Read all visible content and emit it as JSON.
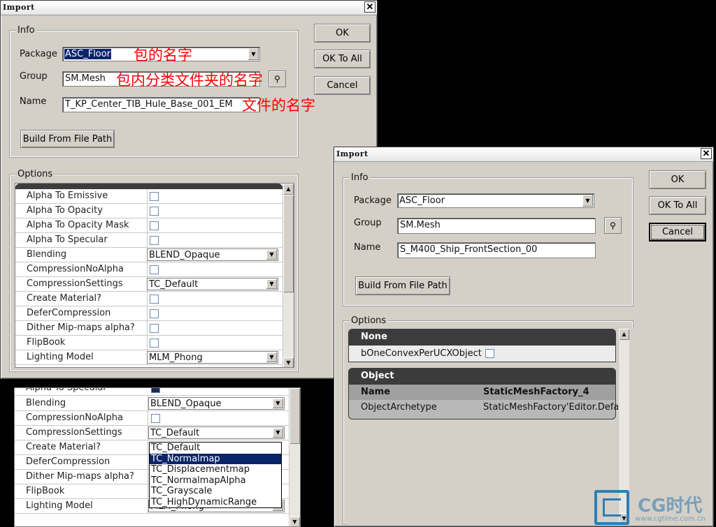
{
  "window1": {
    "title": "Import",
    "close_label": "✕",
    "info_label": "Info",
    "package_label": "Package",
    "package_value": "ASC_Floor",
    "group_label": "Group",
    "group_value": "SM.Mesh",
    "name_label": "Name",
    "name_value": "T_KP_Center_TIB_Hule_Base_001_EM",
    "build_button": "Build From File Path",
    "ok_button": "OK",
    "ok_to_all_button": "OK To All",
    "cancel_button": "Cancel",
    "options_label": "Options",
    "annotations": {
      "package": "包的名字",
      "group": "包内分类文件夹的名字",
      "name": "文件的名字"
    },
    "options": [
      {
        "name": "Alpha To Emissive",
        "type": "checkbox"
      },
      {
        "name": "Alpha To Opacity",
        "type": "checkbox"
      },
      {
        "name": "Alpha To Opacity Mask",
        "type": "checkbox"
      },
      {
        "name": "Alpha To Specular",
        "type": "checkbox"
      },
      {
        "name": "Blending",
        "type": "combo",
        "value": "BLEND_Opaque"
      },
      {
        "name": "CompressionNoAlpha",
        "type": "checkbox"
      },
      {
        "name": "CompressionSettings",
        "type": "combo",
        "value": "TC_Default"
      },
      {
        "name": "Create Material?",
        "type": "checkbox"
      },
      {
        "name": "DeferCompression",
        "type": "checkbox"
      },
      {
        "name": "Dither Mip-maps alpha?",
        "type": "checkbox"
      },
      {
        "name": "FlipBook",
        "type": "checkbox"
      },
      {
        "name": "Lighting Model",
        "type": "combo",
        "value": "MLM_Phong"
      }
    ]
  },
  "window2": {
    "title": "Import",
    "close_label": "✕",
    "info_label": "Info",
    "package_label": "Package",
    "package_value": "ASC_Floor",
    "group_label": "Group",
    "group_value": "SM.Mesh",
    "name_label": "Name",
    "name_value": "S_M400_Ship_FrontSection_00",
    "build_button": "Build From File Path",
    "ok_button": "OK",
    "ok_to_all_button": "OK To All",
    "cancel_button": "Cancel",
    "options_label": "Options",
    "cat_none": "None",
    "none_prop": "bOneConvexPerUCXObject",
    "cat_object": "Object",
    "obj_name_label": "Name",
    "obj_name_value": "StaticMeshFactory_4",
    "obj_arch_label": "ObjectArchetype",
    "obj_arch_value": "StaticMeshFactory'Editor.Defaul"
  },
  "panel3": {
    "partial_top": "Alpha To Specular",
    "options": [
      {
        "name": "Blending",
        "type": "combo",
        "value": "BLEND_Opaque"
      },
      {
        "name": "CompressionNoAlpha",
        "type": "checkbox"
      },
      {
        "name": "CompressionSettings",
        "type": "combo",
        "value": "TC_Default"
      },
      {
        "name": "Create Material?",
        "type": "none"
      },
      {
        "name": "DeferCompression",
        "type": "none"
      },
      {
        "name": "Dither Mip-maps alpha?",
        "type": "none"
      },
      {
        "name": "FlipBook",
        "type": "none"
      },
      {
        "name": "Lighting Model",
        "type": "combo",
        "value": "MLM_Phong"
      }
    ],
    "dropdown": [
      "TC_Default",
      "TC_Normalmap",
      "TC_Displacementmap",
      "TC_NormalmapAlpha",
      "TC_Grayscale",
      "TC_HighDynamicRange"
    ],
    "dropdown_selected": 1
  },
  "watermark": {
    "brand": "CG时代",
    "url": "www.cgtime.com.cn"
  },
  "colors": {
    "window_bg": "#d4d0c8",
    "annotation": "#ff0000",
    "selection": "#0a246a",
    "category_header": "#3c3c3c"
  }
}
